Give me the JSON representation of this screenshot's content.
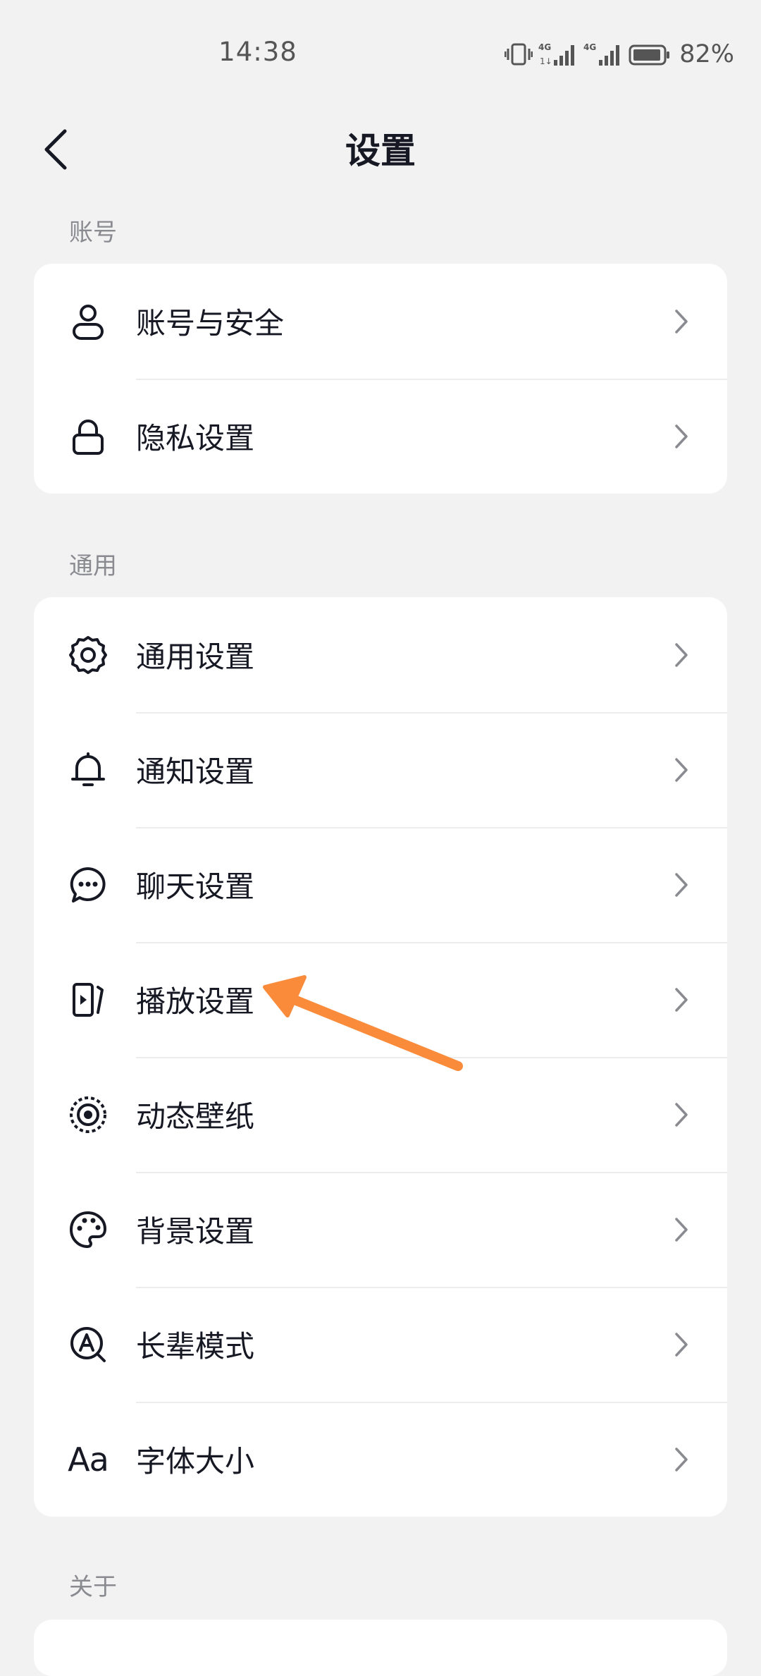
{
  "status_bar": {
    "time": "14:38",
    "battery_percent": "82%",
    "network_1": "4G",
    "network_2": "4G"
  },
  "header": {
    "title": "设置"
  },
  "sections": [
    {
      "label": "账号",
      "items": [
        {
          "label": "账号与安全",
          "icon": "user-icon"
        },
        {
          "label": "隐私设置",
          "icon": "lock-icon"
        }
      ]
    },
    {
      "label": "通用",
      "items": [
        {
          "label": "通用设置",
          "icon": "gear-icon"
        },
        {
          "label": "通知设置",
          "icon": "bell-icon"
        },
        {
          "label": "聊天设置",
          "icon": "chat-bubble-icon"
        },
        {
          "label": "播放设置",
          "icon": "play-settings-icon"
        },
        {
          "label": "动态壁纸",
          "icon": "live-wallpaper-icon"
        },
        {
          "label": "背景设置",
          "icon": "palette-icon"
        },
        {
          "label": "长辈模式",
          "icon": "elder-mode-icon"
        },
        {
          "label": "字体大小",
          "icon": "font-size-icon",
          "icon_text": "Aa"
        }
      ]
    },
    {
      "label": "关于",
      "items": []
    }
  ],
  "annotation": {
    "type": "arrow",
    "color": "#f98b3a",
    "points_to": "播放设置"
  }
}
